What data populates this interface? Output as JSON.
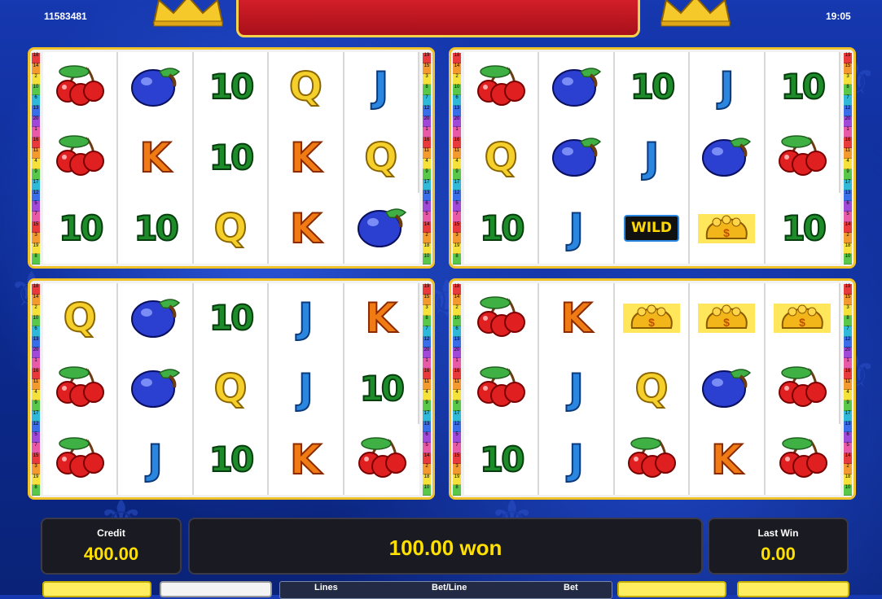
{
  "header": {
    "ticket_id": "11583481",
    "clock": "19:05"
  },
  "colors": {
    "background": "#1638b0",
    "panel_border": "#f0c22a",
    "value_text": "#ffe000"
  },
  "paylines": {
    "left": [
      "18",
      "14",
      "2",
      "10",
      "6",
      "13",
      "20",
      "1",
      "16",
      "11",
      "4",
      "9",
      "17",
      "12",
      "5",
      "7",
      "15",
      "3",
      "19",
      "8"
    ],
    "right": [
      "19",
      "15",
      "3",
      "8",
      "7",
      "12",
      "20",
      "1",
      "16",
      "11",
      "4",
      "9",
      "17",
      "13",
      "6",
      "5",
      "14",
      "2",
      "18",
      "10"
    ]
  },
  "panels": [
    {
      "reels": [
        [
          "cherry-icon",
          "cherry-icon",
          "10"
        ],
        [
          "plum-icon",
          "K",
          "10"
        ],
        [
          "10",
          "10",
          "Q"
        ],
        [
          "Q",
          "K",
          "K"
        ],
        [
          "J",
          "Q",
          "plum-icon"
        ]
      ]
    },
    {
      "reels": [
        [
          "cherry-icon",
          "Q",
          "10"
        ],
        [
          "plum-icon",
          "plum-icon",
          "J"
        ],
        [
          "10",
          "J",
          "WILD"
        ],
        [
          "J",
          "plum-icon",
          "gold-bag-icon"
        ],
        [
          "10",
          "cherry-icon",
          "10"
        ]
      ]
    },
    {
      "reels": [
        [
          "Q",
          "cherry-icon",
          "cherry-icon"
        ],
        [
          "plum-icon",
          "plum-icon",
          "J"
        ],
        [
          "10",
          "Q",
          "10"
        ],
        [
          "J",
          "J",
          "K"
        ],
        [
          "K",
          "10",
          "cherry-icon"
        ]
      ]
    },
    {
      "reels": [
        [
          "cherry-icon",
          "cherry-icon",
          "10"
        ],
        [
          "K",
          "J",
          "J"
        ],
        [
          "gold-bag-icon",
          "Q",
          "cherry-icon"
        ],
        [
          "gold-bag-icon",
          "plum-icon",
          "K"
        ],
        [
          "gold-bag-icon",
          "cherry-icon",
          "cherry-icon"
        ]
      ]
    }
  ],
  "status": {
    "credit_label": "Credit",
    "credit_value": "400.00",
    "message": "100.00 won",
    "last_win_label": "Last Win",
    "last_win_value": "0.00"
  },
  "controls": {
    "lines_label": "Lines",
    "bet_line_label": "Bet/Line",
    "bet_label": "Bet"
  }
}
